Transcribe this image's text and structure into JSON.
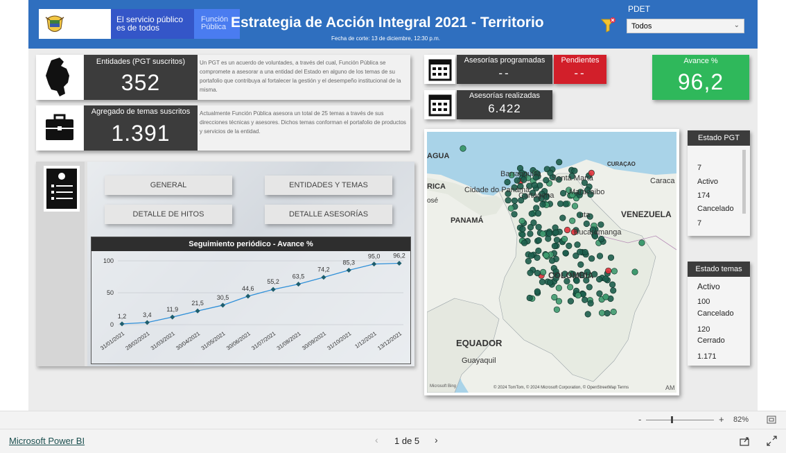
{
  "header": {
    "logo_left": "El servicio público es de todos",
    "logo_right": "Función Pública",
    "title": "Estrategia de Acción Integral 2021 - Territorio",
    "cutoff": "Fecha de corte: 13 de diciembre, 12:30 p.m.",
    "pdet_label": "PDET",
    "pdet_value": "Todos"
  },
  "kpis": {
    "entidades_label": "Entidades (PGT suscritos)",
    "entidades_value": "352",
    "entidades_desc": "Un PGT es un acuerdo de voluntades, a través del cual, Función Pública se compromete a asesorar a una entidad del Estado en alguno de los temas de su portafolio que contribuya al fortalecer la gestión y el desempeño institucional de la misma.",
    "temas_label": "Agregado de temas suscritos",
    "temas_value": "1.391",
    "temas_desc": "Actualmente Función Pública asesora un total de 25 temas a través de sus direcciones técnicas y asesores. Dichos temas conforman el portafolio de productos y servicios de la entidad.",
    "programadas_label": "Asesorías programadas",
    "programadas_value": "--",
    "pendientes_label": "Pendientes",
    "pendientes_value": "--",
    "realizadas_label": "Asesorías realizadas",
    "realizadas_value": "6.422",
    "avance_label": "Avance %",
    "avance_value": "96,2"
  },
  "nav": {
    "general": "GENERAL",
    "entidades_temas": "ENTIDADES Y TEMAS",
    "detalle_hitos": "DETALLE DE HITOS",
    "detalle_asesorias": "DETALLE ASESORÍAS"
  },
  "chart_data": {
    "type": "line",
    "title": "Seguimiento periódico - Avance %",
    "categories": [
      "31/01/2021",
      "28/02/2021",
      "31/03/2021",
      "30/04/2021",
      "31/05/2021",
      "30/06/2021",
      "31/07/2021",
      "31/08/2021",
      "30/09/2021",
      "31/10/2021",
      "1/12/2021",
      "13/12/2021"
    ],
    "values": [
      1.2,
      3.4,
      11.9,
      21.5,
      30.5,
      44.6,
      55.2,
      63.5,
      74.2,
      85.3,
      95.0,
      96.2
    ],
    "value_labels": [
      "1,2",
      "3,4",
      "11,9",
      "21,5",
      "30,5",
      "44,6",
      "55,2",
      "63,5",
      "74,2",
      "85,3",
      "95,0",
      "96,2"
    ],
    "yticks": [
      "0",
      "50",
      "100"
    ],
    "ylim": [
      0,
      100
    ],
    "line_color": "#2e8fd8",
    "marker_color": "#1e5e6e"
  },
  "map": {
    "labels": {
      "aguas": "AGUA",
      "barranquilla": "Barranquilla",
      "santa_marta": "Santa Marta",
      "curacao": "CURAÇAO",
      "caracas": "Caraca",
      "rica": "RICA",
      "ciudad_panama": "Cidade do Panamá",
      "cartagena": "Cartagena",
      "maracaibo": "Maracaibo",
      "jose": "osé",
      "panama": "PANAMÁ",
      "venezuela": "VENEZUELA",
      "cucuta": "uta",
      "bucaramanga": "Bucaramanga",
      "colombia": "COLOMBIA",
      "ecuador": "EQUADOR",
      "guayaquil": "Guayaquil"
    },
    "attribution": "© 2024 TomTom, © 2024 Microsoft Corporation, © OpenStreetMap  Terms",
    "bing": "Microsoft Bing",
    "am": "AM"
  },
  "estado_pgt": {
    "title": "Estado PGT",
    "items": [
      "7",
      "Activo",
      "174",
      "Cancelado",
      "7"
    ]
  },
  "estado_temas": {
    "title": "Estado temas",
    "items": [
      "Activo",
      "100",
      "Cancelado",
      "120",
      "Cerrado",
      "1.171"
    ]
  },
  "zoom": {
    "minus": "-",
    "plus": "+",
    "value": "82%"
  },
  "footer": {
    "brand": "Microsoft Power BI",
    "page": "1 de 5"
  }
}
